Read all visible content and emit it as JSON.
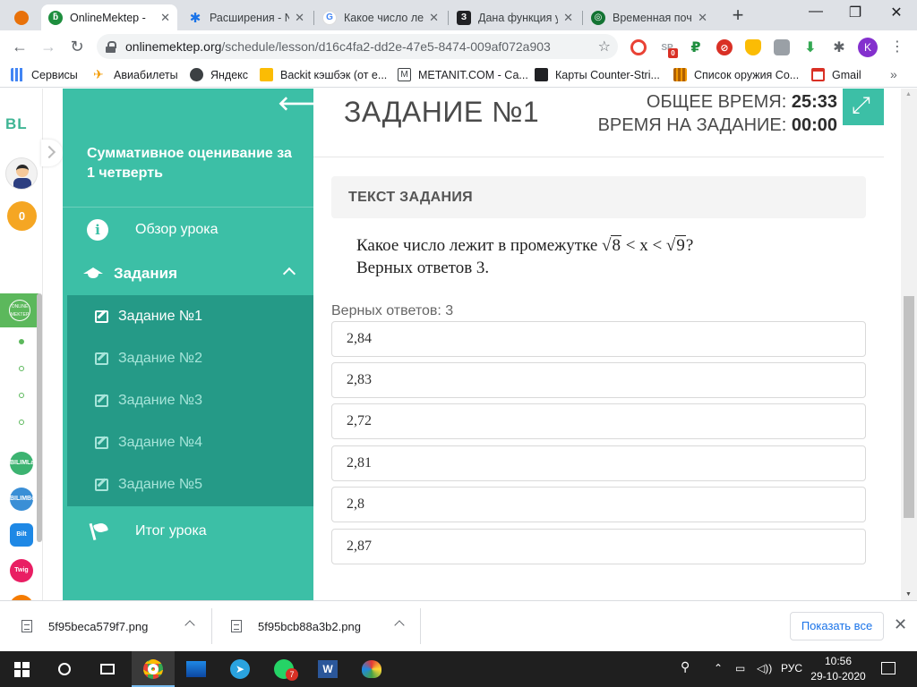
{
  "browser": {
    "tabs": [
      {
        "label": "",
        "icon": "opera-like-icon",
        "color": "#e8710a"
      },
      {
        "label": "OnlineMektep -",
        "icon": "onlinemektep-icon",
        "color": "#1e8e3e",
        "active": true
      },
      {
        "label": "Расширения - N",
        "icon": "puzzle-icon",
        "color": "#1a73e8"
      },
      {
        "label": "Какое число ле",
        "icon": "google-icon",
        "color": "#4285f4"
      },
      {
        "label": "Дана функция у",
        "icon": "znanija-icon",
        "color": "#202124"
      },
      {
        "label": "Временная поч",
        "icon": "mail-icon",
        "color": "#137333"
      }
    ],
    "url_host": "onlinemektep.org",
    "url_path": "/schedule/lesson/d16c4fa2-dd2e-47e5-8474-009af072a903",
    "profile_initial": "K",
    "ext_badge": "0",
    "bookmarks": [
      {
        "label": "Сервисы",
        "icon": "apps-grid-icon",
        "color": "#5f6368"
      },
      {
        "label": "Авиабилеты",
        "icon": "airplane-icon",
        "color": "#f29900"
      },
      {
        "label": "Яндекс",
        "icon": "globe-icon",
        "color": "#3c4043"
      },
      {
        "label": "Backit кэшбэк (от е...",
        "icon": "backit-icon",
        "color": "#fbbc04"
      },
      {
        "label": "METANIT.COM - Са...",
        "icon": "metanit-icon",
        "color": "#3c4043"
      },
      {
        "label": "Карты Counter-Stri...",
        "icon": "tsar-icon",
        "color": "#202124"
      },
      {
        "label": "Список оружия Co...",
        "icon": "books-icon",
        "color": "#b06000"
      },
      {
        "label": "Gmail",
        "icon": "gmail-icon",
        "color": "#d93025"
      }
    ]
  },
  "rail": {
    "logo": "BL",
    "coins": "0",
    "apps": [
      {
        "label": "BILIMLand",
        "color": "#3cb371"
      },
      {
        "label": "BILIMBook",
        "color": "#3a8fd6"
      },
      {
        "label": "Bilt",
        "color": "#1e88e5"
      },
      {
        "label": "Twig",
        "color": "#e91e63"
      }
    ]
  },
  "sidebar": {
    "title": "Суммативное оценивание за 1 четверть",
    "overview": "Обзор урока",
    "tasks_section": "Задания",
    "tasks": [
      "Задание №1",
      "Задание №2",
      "Задание №3",
      "Задание №4",
      "Задание №5"
    ],
    "current_task_index": 0,
    "result": "Итог урока"
  },
  "main": {
    "task_title": "ЗАДАНИЕ №1",
    "total_time_label": "ОБЩЕЕ ВРЕМЯ:",
    "total_time": "25:33",
    "task_time_label": "ВРЕМЯ НА ЗАДАНИЕ:",
    "task_time": "00:00",
    "panel_title": "ТЕКСТ ЗАДАНИЯ",
    "question_prefix": "Какое число лежит в промежутке ",
    "radical_a": "8",
    "question_middle": " < x < ",
    "radical_b": "9",
    "question_suffix": "?",
    "question_line2": "Верных ответов 3.",
    "answers_hint": "Верных ответов: 3",
    "answers": [
      "2,84",
      "2,83",
      "2,72",
      "2,81",
      "2,8",
      "2,87"
    ]
  },
  "downloads": {
    "files": [
      "5f95beca579f7.png",
      "5f95bcb88a3b2.png"
    ],
    "show_all": "Показать все"
  },
  "taskbar": {
    "language": "РУС",
    "time": "10:56",
    "date": "29-10-2020",
    "whatsapp_badge": "7"
  }
}
